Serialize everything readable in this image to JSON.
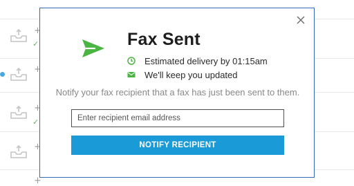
{
  "modal": {
    "title": "Fax Sent",
    "delivery_text": "Estimated delivery by 01:15am",
    "updates_text": "We'll keep you updated",
    "notify_description": "Notify your fax recipient that a fax has just been sent to them.",
    "email_placeholder": "Enter recipient email address",
    "notify_button_label": "NOTIFY RECIPIENT",
    "icons": {
      "send": "paper-plane-icon",
      "clock": "clock-icon",
      "mail": "envelope-icon",
      "close": "close-icon"
    }
  },
  "colors": {
    "accent_green": "#4bb543",
    "button_blue": "#1a9ad6",
    "modal_border": "#2d6bb8"
  }
}
